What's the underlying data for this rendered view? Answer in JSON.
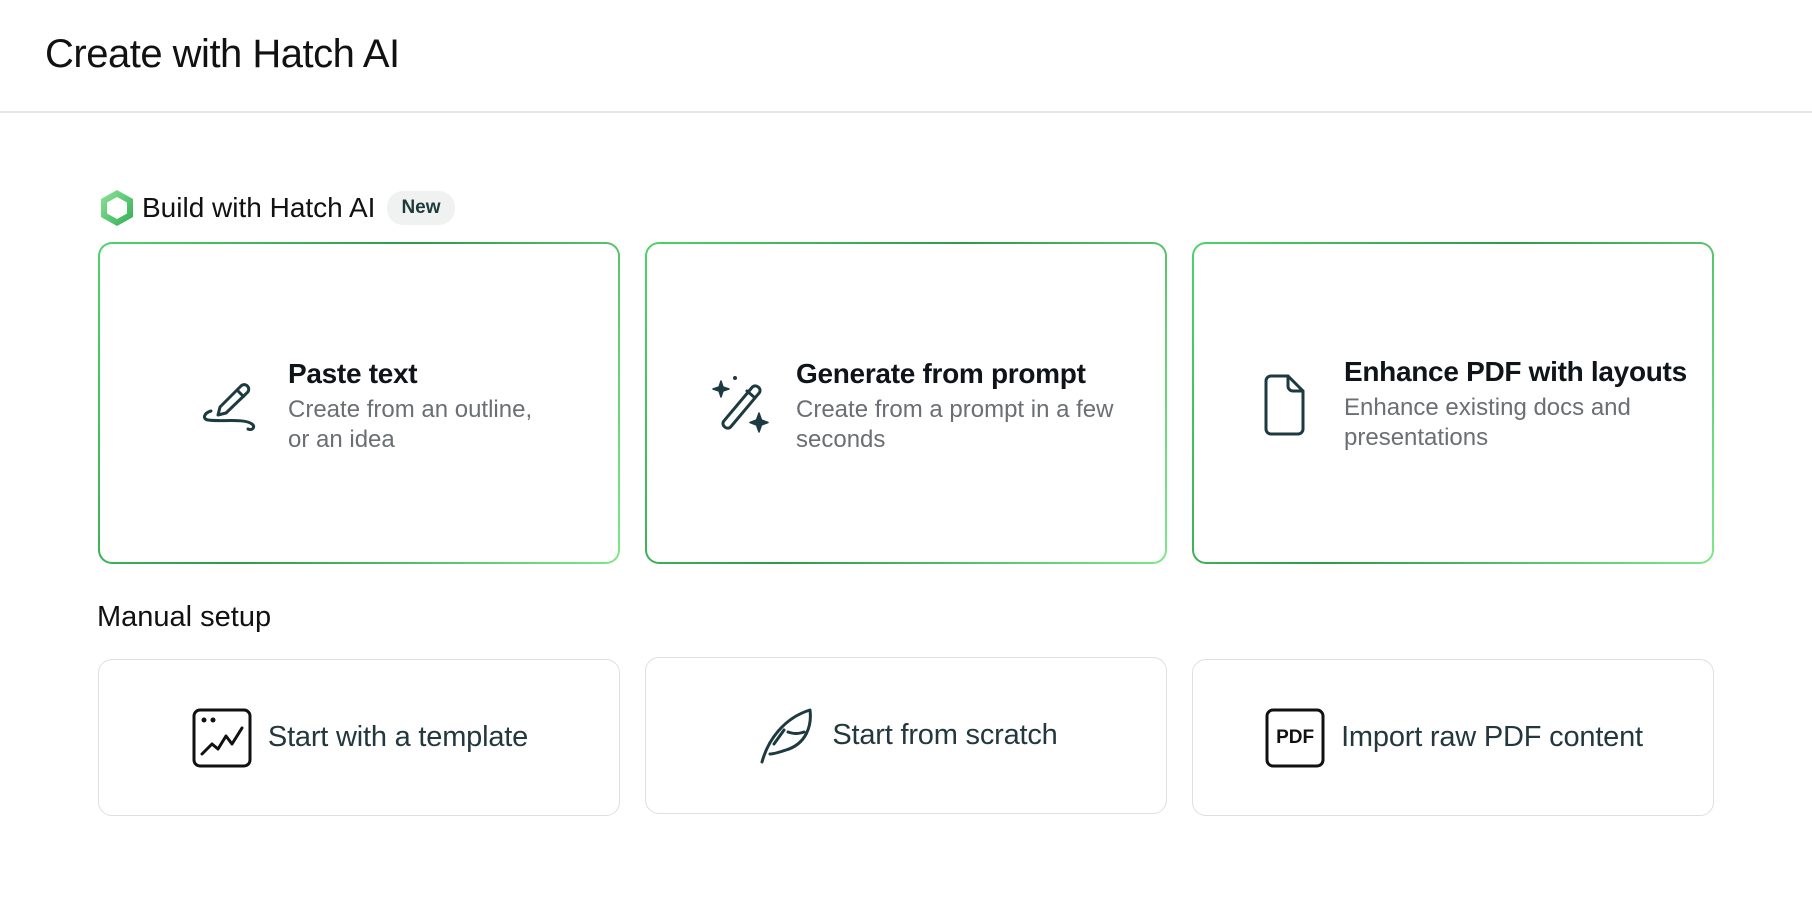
{
  "header": {
    "title": "Create with Hatch AI"
  },
  "ai_section": {
    "title": "Build with Hatch AI",
    "badge": "New",
    "logo_icon": "hatch-hexagon-icon",
    "cards": [
      {
        "title": "Paste text",
        "desc_line1": "Create from an outline,",
        "desc_line2": "or an idea",
        "icon": "pen-scribble-icon"
      },
      {
        "title": "Generate from prompt",
        "desc_line1": "Create from a prompt in a few",
        "desc_line2": "seconds",
        "icon": "magic-wand-icon"
      },
      {
        "title": "Enhance PDF with layouts",
        "desc_line1": "Enhance existing docs and",
        "desc_line2": "presentations",
        "icon": "document-icon"
      }
    ]
  },
  "manual_section": {
    "title": "Manual setup",
    "cards": [
      {
        "label": "Start with a template",
        "icon": "template-chart-icon"
      },
      {
        "label": "Start from scratch",
        "icon": "feather-icon"
      },
      {
        "label": "Import raw PDF content",
        "icon": "pdf-icon",
        "icon_text": "PDF"
      }
    ]
  },
  "colors": {
    "accent_green": "#3fbf5c",
    "icon_stroke": "#1c3a40",
    "muted_text": "#6b6f73"
  }
}
